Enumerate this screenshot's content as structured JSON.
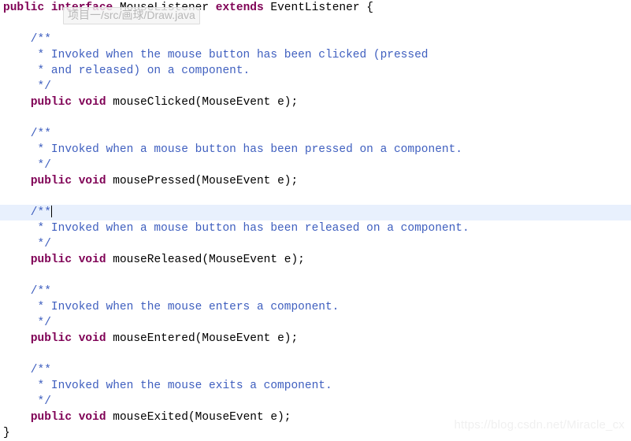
{
  "editor": {
    "background_color": "#ffffff",
    "keyword_color": "#7f0055",
    "comment_color": "#3f5fbf",
    "plain_color": "#000000",
    "current_line_highlight_color": "#e8f0fd",
    "lines": [
      {
        "id": "l1",
        "indent": 0,
        "highlight": false,
        "caret": false,
        "tokens": [
          {
            "type": "kw",
            "text": "public"
          },
          {
            "type": "plain",
            "text": " "
          },
          {
            "type": "kw",
            "text": "interface"
          },
          {
            "type": "plain",
            "text": " MouseListener "
          },
          {
            "type": "kw",
            "text": "extends"
          },
          {
            "type": "plain",
            "text": " EventListener {"
          }
        ]
      },
      {
        "id": "l2",
        "indent": 0,
        "highlight": false,
        "caret": false,
        "tokens": []
      },
      {
        "id": "l3",
        "indent": 0,
        "highlight": false,
        "caret": false,
        "tokens": [
          {
            "type": "cmt",
            "text": "    /**"
          }
        ]
      },
      {
        "id": "l4",
        "indent": 0,
        "highlight": false,
        "caret": false,
        "tokens": [
          {
            "type": "cmt",
            "text": "     * Invoked when the mouse button has been clicked (pressed"
          }
        ]
      },
      {
        "id": "l5",
        "indent": 0,
        "highlight": false,
        "caret": false,
        "tokens": [
          {
            "type": "cmt",
            "text": "     * and released) on a component."
          }
        ]
      },
      {
        "id": "l6",
        "indent": 0,
        "highlight": false,
        "caret": false,
        "tokens": [
          {
            "type": "cmt",
            "text": "     */"
          }
        ]
      },
      {
        "id": "l7",
        "indent": 0,
        "highlight": false,
        "caret": false,
        "tokens": [
          {
            "type": "plain",
            "text": "    "
          },
          {
            "type": "kw",
            "text": "public"
          },
          {
            "type": "plain",
            "text": " "
          },
          {
            "type": "kw",
            "text": "void"
          },
          {
            "type": "plain",
            "text": " mouseClicked(MouseEvent e);"
          }
        ]
      },
      {
        "id": "l8",
        "indent": 0,
        "highlight": false,
        "caret": false,
        "tokens": []
      },
      {
        "id": "l9",
        "indent": 0,
        "highlight": false,
        "caret": false,
        "tokens": [
          {
            "type": "cmt",
            "text": "    /**"
          }
        ]
      },
      {
        "id": "l10",
        "indent": 0,
        "highlight": false,
        "caret": false,
        "tokens": [
          {
            "type": "cmt",
            "text": "     * Invoked when a mouse button has been pressed on a component."
          }
        ]
      },
      {
        "id": "l11",
        "indent": 0,
        "highlight": false,
        "caret": false,
        "tokens": [
          {
            "type": "cmt",
            "text": "     */"
          }
        ]
      },
      {
        "id": "l12",
        "indent": 0,
        "highlight": false,
        "caret": false,
        "tokens": [
          {
            "type": "plain",
            "text": "    "
          },
          {
            "type": "kw",
            "text": "public"
          },
          {
            "type": "plain",
            "text": " "
          },
          {
            "type": "kw",
            "text": "void"
          },
          {
            "type": "plain",
            "text": " mousePressed(MouseEvent e);"
          }
        ]
      },
      {
        "id": "l13",
        "indent": 0,
        "highlight": false,
        "caret": false,
        "tokens": []
      },
      {
        "id": "l14",
        "indent": 0,
        "highlight": true,
        "caret": true,
        "tokens": [
          {
            "type": "cmt",
            "text": "    /**"
          }
        ]
      },
      {
        "id": "l15",
        "indent": 0,
        "highlight": false,
        "caret": false,
        "tokens": [
          {
            "type": "cmt",
            "text": "     * Invoked when a mouse button has been released on a component."
          }
        ]
      },
      {
        "id": "l16",
        "indent": 0,
        "highlight": false,
        "caret": false,
        "tokens": [
          {
            "type": "cmt",
            "text": "     */"
          }
        ]
      },
      {
        "id": "l17",
        "indent": 0,
        "highlight": false,
        "caret": false,
        "tokens": [
          {
            "type": "plain",
            "text": "    "
          },
          {
            "type": "kw",
            "text": "public"
          },
          {
            "type": "plain",
            "text": " "
          },
          {
            "type": "kw",
            "text": "void"
          },
          {
            "type": "plain",
            "text": " mouseReleased(MouseEvent e);"
          }
        ]
      },
      {
        "id": "l18",
        "indent": 0,
        "highlight": false,
        "caret": false,
        "tokens": []
      },
      {
        "id": "l19",
        "indent": 0,
        "highlight": false,
        "caret": false,
        "tokens": [
          {
            "type": "cmt",
            "text": "    /**"
          }
        ]
      },
      {
        "id": "l20",
        "indent": 0,
        "highlight": false,
        "caret": false,
        "tokens": [
          {
            "type": "cmt",
            "text": "     * Invoked when the mouse enters a component."
          }
        ]
      },
      {
        "id": "l21",
        "indent": 0,
        "highlight": false,
        "caret": false,
        "tokens": [
          {
            "type": "cmt",
            "text": "     */"
          }
        ]
      },
      {
        "id": "l22",
        "indent": 0,
        "highlight": false,
        "caret": false,
        "tokens": [
          {
            "type": "plain",
            "text": "    "
          },
          {
            "type": "kw",
            "text": "public"
          },
          {
            "type": "plain",
            "text": " "
          },
          {
            "type": "kw",
            "text": "void"
          },
          {
            "type": "plain",
            "text": " mouseEntered(MouseEvent e);"
          }
        ]
      },
      {
        "id": "l23",
        "indent": 0,
        "highlight": false,
        "caret": false,
        "tokens": []
      },
      {
        "id": "l24",
        "indent": 0,
        "highlight": false,
        "caret": false,
        "tokens": [
          {
            "type": "cmt",
            "text": "    /**"
          }
        ]
      },
      {
        "id": "l25",
        "indent": 0,
        "highlight": false,
        "caret": false,
        "tokens": [
          {
            "type": "cmt",
            "text": "     * Invoked when the mouse exits a component."
          }
        ]
      },
      {
        "id": "l26",
        "indent": 0,
        "highlight": false,
        "caret": false,
        "tokens": [
          {
            "type": "cmt",
            "text": "     */"
          }
        ]
      },
      {
        "id": "l27",
        "indent": 0,
        "highlight": false,
        "caret": false,
        "tokens": [
          {
            "type": "plain",
            "text": "    "
          },
          {
            "type": "kw",
            "text": "public"
          },
          {
            "type": "plain",
            "text": " "
          },
          {
            "type": "kw",
            "text": "void"
          },
          {
            "type": "plain",
            "text": " mouseExited(MouseEvent e);"
          }
        ]
      },
      {
        "id": "l28",
        "indent": 0,
        "highlight": false,
        "caret": false,
        "tokens": [
          {
            "type": "plain",
            "text": "}"
          }
        ]
      }
    ]
  },
  "path_tooltip": {
    "text": "项目一/src/画球/Draw.java"
  },
  "watermark": {
    "text": "https://blog.csdn.net/Miracle_cx"
  }
}
